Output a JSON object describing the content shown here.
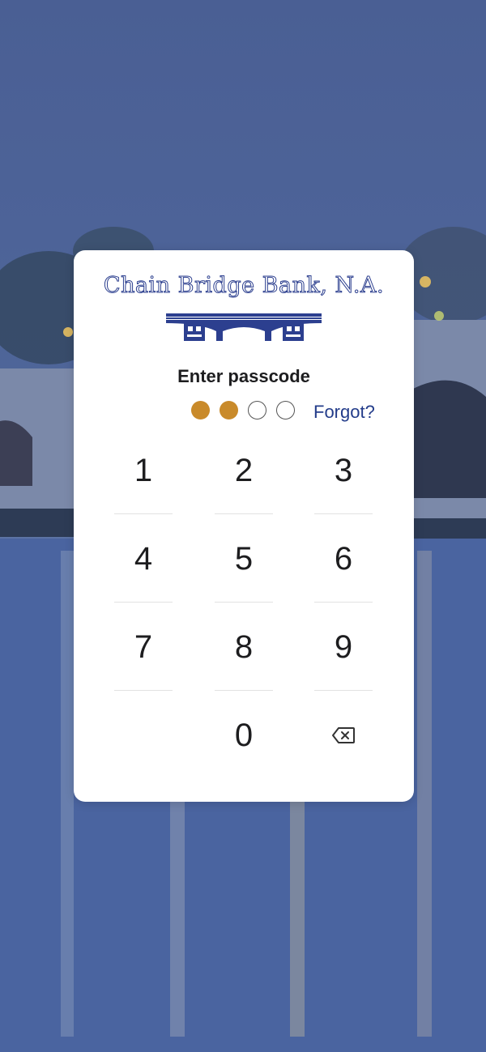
{
  "bank": {
    "name": "Chain Bridge Bank, N.A."
  },
  "passcode": {
    "prompt": "Enter passcode",
    "entered": 2,
    "length": 4,
    "forgot_label": "Forgot?",
    "accent_color": "#c98a2a"
  },
  "keypad": {
    "keys": [
      "1",
      "2",
      "3",
      "4",
      "5",
      "6",
      "7",
      "8",
      "9",
      "0"
    ],
    "delete_icon": "backspace-icon"
  }
}
